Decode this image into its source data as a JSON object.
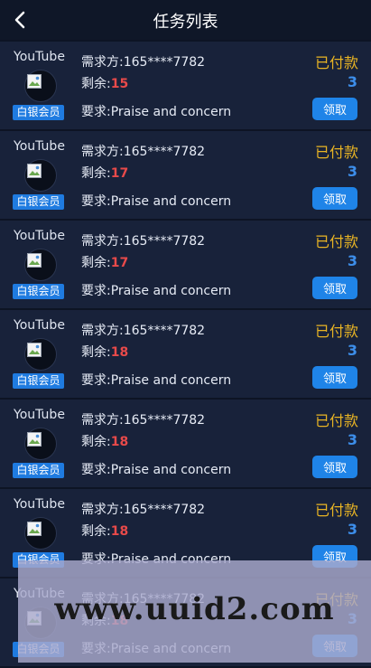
{
  "header": {
    "title": "任务列表",
    "back_icon": "chevron-left-icon"
  },
  "tasks": [
    {
      "platform": "YouTube",
      "badge": "白银会员",
      "requester_label": "需求方:",
      "requester": "165****7782",
      "remain_label": "剩余:",
      "remain": "15",
      "require_label": "要求:",
      "require": "Praise and concern",
      "status": "已付款",
      "count": "3",
      "button": "领取"
    },
    {
      "platform": "YouTube",
      "badge": "白银会员",
      "requester_label": "需求方:",
      "requester": "165****7782",
      "remain_label": "剩余:",
      "remain": "17",
      "require_label": "要求:",
      "require": "Praise and concern",
      "status": "已付款",
      "count": "3",
      "button": "领取"
    },
    {
      "platform": "YouTube",
      "badge": "白银会员",
      "requester_label": "需求方:",
      "requester": "165****7782",
      "remain_label": "剩余:",
      "remain": "17",
      "require_label": "要求:",
      "require": "Praise and concern",
      "status": "已付款",
      "count": "3",
      "button": "领取"
    },
    {
      "platform": "YouTube",
      "badge": "白银会员",
      "requester_label": "需求方:",
      "requester": "165****7782",
      "remain_label": "剩余:",
      "remain": "18",
      "require_label": "要求:",
      "require": "Praise and concern",
      "status": "已付款",
      "count": "3",
      "button": "领取"
    },
    {
      "platform": "YouTube",
      "badge": "白银会员",
      "requester_label": "需求方:",
      "requester": "165****7782",
      "remain_label": "剩余:",
      "remain": "18",
      "require_label": "要求:",
      "require": "Praise and concern",
      "status": "已付款",
      "count": "3",
      "button": "领取"
    },
    {
      "platform": "YouTube",
      "badge": "白银会员",
      "requester_label": "需求方:",
      "requester": "165****7782",
      "remain_label": "剩余:",
      "remain": "18",
      "require_label": "要求:",
      "require": "Praise and concern",
      "status": "已付款",
      "count": "3",
      "button": "领取"
    },
    {
      "platform": "YouTube",
      "badge": "白银会员",
      "requester_label": "需求方:",
      "requester": "165****7782",
      "remain_label": "剩余:",
      "remain": "18",
      "require_label": "要求:",
      "require": "Praise and concern",
      "status": "已付款",
      "count": "3",
      "button": "领取"
    }
  ],
  "watermark": {
    "text": "www.uuid2.com"
  },
  "colors": {
    "background": "#0d1424",
    "card": "#18223a",
    "status": "#e8b424",
    "remain": "#e84a4a",
    "count": "#3d8eea",
    "button": "#1f84e8",
    "badge": "#1f7be0"
  }
}
